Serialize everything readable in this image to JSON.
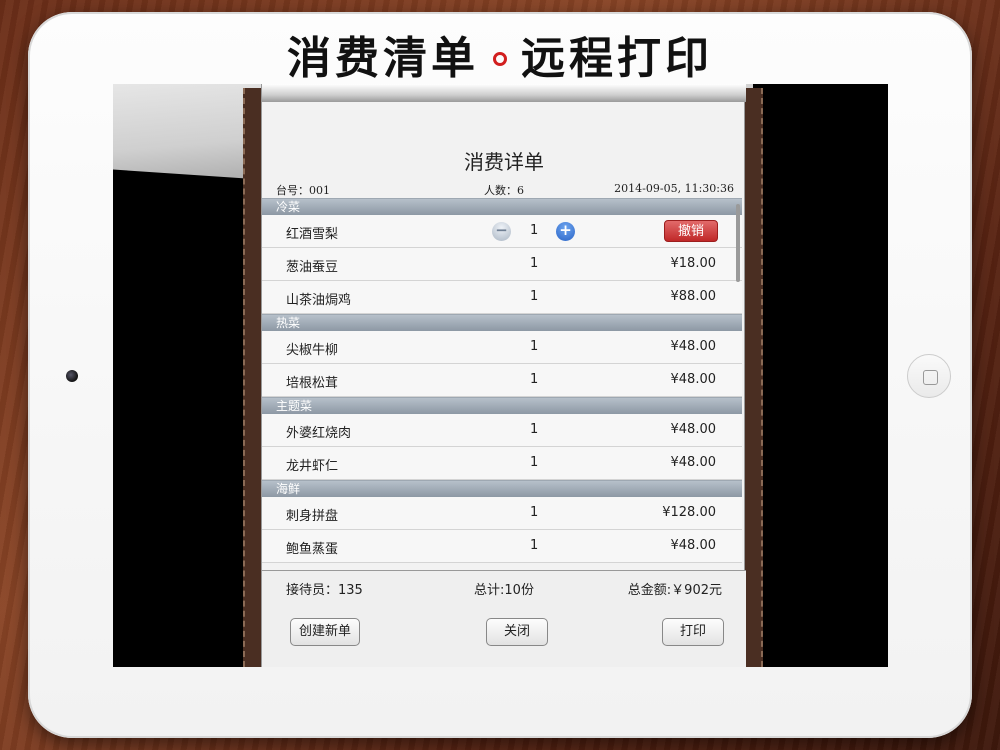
{
  "headline": {
    "left": "消费清单",
    "right": "远程打印"
  },
  "bill": {
    "title": "消费详单",
    "table_label": "台号：001",
    "people_label": "人数：6",
    "timestamp": "2014-09-05, 11:30:36"
  },
  "sections": [
    {
      "title": "冷菜",
      "items": [
        {
          "name": "红酒雪梨",
          "qty": "1",
          "action": "撤销",
          "stepper": true
        },
        {
          "name": "葱油蚕豆",
          "qty": "1",
          "price": "¥18.00"
        },
        {
          "name": "山茶油焗鸡",
          "qty": "1",
          "price": "¥88.00"
        }
      ]
    },
    {
      "title": "热菜",
      "items": [
        {
          "name": "尖椒牛柳",
          "qty": "1",
          "price": "¥48.00"
        },
        {
          "name": "培根松茸",
          "qty": "1",
          "price": "¥48.00"
        }
      ]
    },
    {
      "title": "主题菜",
      "items": [
        {
          "name": "外婆红烧肉",
          "qty": "1",
          "price": "¥48.00"
        },
        {
          "name": "龙井虾仁",
          "qty": "1",
          "price": "¥48.00"
        }
      ]
    },
    {
      "title": "海鲜",
      "items": [
        {
          "name": "刺身拼盘",
          "qty": "1",
          "price": "¥128.00"
        },
        {
          "name": "鲍鱼蒸蛋",
          "qty": "1",
          "price": "¥48.00"
        }
      ]
    }
  ],
  "footer": {
    "waiter": "接待员：135",
    "total_count": "总计:10份",
    "total_amount": "总金额:￥902元"
  },
  "buttons": {
    "new_order": "创建新单",
    "close": "关闭",
    "print": "打印"
  },
  "stepper": {
    "minus": "−",
    "plus": "+"
  },
  "colors": {
    "section_header": "#8d98a4",
    "undo_button": "#c02828",
    "plus_button": "#2a64c7",
    "headline_dot": "#d21f1f"
  }
}
